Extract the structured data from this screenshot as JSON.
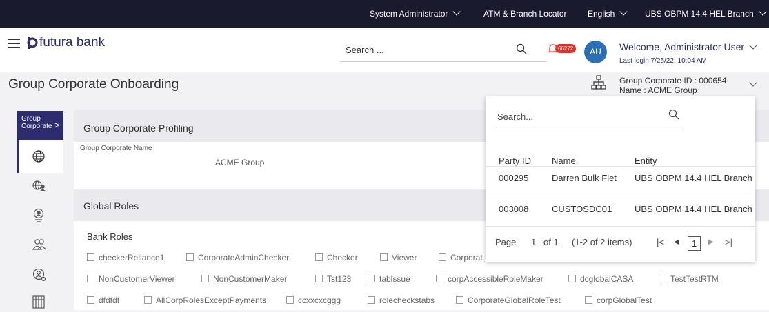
{
  "topbar": {
    "role": "System Administrator",
    "atm": "ATM & Branch Locator",
    "language": "English",
    "branch": "UBS OBPM 14.4 HEL Branch"
  },
  "header": {
    "logo_text": "futura bank",
    "search_placeholder": "Search ...",
    "notification_count": "66272",
    "avatar_initials": "AU",
    "welcome": "Welcome, Administrator User",
    "last_login": "Last login 7/25/22, 10:04 AM"
  },
  "page": {
    "title": "Group Corporate Onboarding",
    "gc_id": "Group Corporate ID : 000654",
    "gc_name": "Name : ACME Group"
  },
  "sidebar": {
    "tab_line1": "Group",
    "tab_line2": "Corporate",
    "tab_arrow": ">",
    "icons": [
      "globe-icon",
      "globe-users-icon",
      "user-badge-icon",
      "users-group-icon",
      "user-settings-icon",
      "building-icon"
    ]
  },
  "profiling": {
    "section_title": "Group Corporate Profiling",
    "name_label": "Group Corporate Name",
    "name_value": "ACME Group"
  },
  "roles": {
    "section_title": "Global Roles",
    "bank_roles_label": "Bank Roles",
    "rows": [
      [
        "checkerReliance1",
        "CorporateAdminChecker",
        "Checker",
        "Viewer",
        "Corporat"
      ],
      [
        "NonCustomerViewer",
        "NonCustomerMaker",
        "Tst123",
        "tablssue",
        "corpAccessibleRoleMaker",
        "dcglobalCASA",
        "TestTestRTM"
      ],
      [
        "dfdfdf",
        "AllCorpRolesExceptPayments",
        "ccxxcxcggg",
        "rolecheckstabs",
        "CorporateGlobalRoleTest",
        "corpGlobalTest"
      ]
    ]
  },
  "popup": {
    "search_placeholder": "Search...",
    "headers": [
      "Party ID",
      "Name",
      "Entity"
    ],
    "rows": [
      [
        "000295",
        "Darren Bulk Flet",
        "UBS OBPM 14.4 HEL Branch"
      ],
      [
        "003008",
        "CUSTOSDC01",
        "UBS OBPM 14.4 HEL Branch"
      ]
    ],
    "pager": {
      "page_label": "Page",
      "page_num": "1",
      "of_label": "of 1",
      "items": "(1-2 of 2 items)",
      "current": "1"
    }
  }
}
